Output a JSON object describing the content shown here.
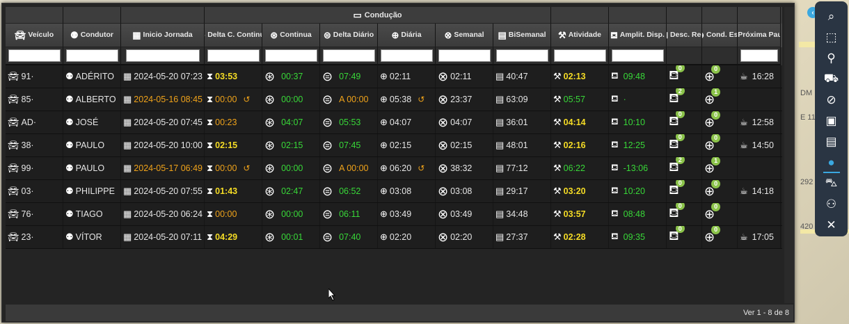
{
  "group_header": {
    "label": "Condução",
    "icon": "id-card-icon"
  },
  "columns": [
    {
      "key": "veiculo",
      "label": "Veículo",
      "icon": "car-icon",
      "width": 83,
      "filter": true
    },
    {
      "key": "condutor",
      "label": "Condutor",
      "icon": "user-gear-icon",
      "width": 83,
      "filter": true
    },
    {
      "key": "inicio",
      "label": "Inicio Jornada",
      "icon": "calendar-icon",
      "width": 120,
      "filter": true
    },
    {
      "key": "delta_c",
      "label": "Delta C. Continua",
      "icon": "steering-wheel-x-icon",
      "width": 83,
      "filter": true
    },
    {
      "key": "continua",
      "label": "Continua",
      "icon": "steering-wheel-x-icon",
      "width": 83,
      "filter": true
    },
    {
      "key": "delta_d",
      "label": "Delta Diário",
      "icon": "steering-hourglass-icon",
      "width": 83,
      "filter": true
    },
    {
      "key": "diaria",
      "label": "Diária",
      "icon": "steering-wheel-icon",
      "width": 83,
      "filter": true
    },
    {
      "key": "semanal",
      "label": "Semanal",
      "icon": "steering-calendar-icon",
      "width": 83,
      "filter": true
    },
    {
      "key": "bisemanal",
      "label": "BiSemanal",
      "icon": "calendar-id-icon",
      "width": 83,
      "filter": true
    },
    {
      "key": "atividade",
      "label": "Atividade",
      "icon": "tools-icon",
      "width": 83,
      "filter": true
    },
    {
      "key": "amplit",
      "label": "Amplit. Disp.",
      "icon": "bed-icon",
      "width": 83,
      "filter": true
    },
    {
      "key": "desc",
      "label": "Desc. Red.",
      "icon": "bed-icon",
      "width": 51,
      "filter": false
    },
    {
      "key": "cond",
      "label": "Cond. Est.",
      "icon": "steering-wheel-icon",
      "width": 51,
      "filter": false
    },
    {
      "key": "proxima",
      "label": "Próxima Pausa",
      "icon": "coffee-icon",
      "width": 62,
      "filter": true
    }
  ],
  "rows": [
    {
      "veiculo": "91·",
      "condutor": "ADÉRITO",
      "inicio": "2024-05-20 07:23",
      "inicio_color": "white",
      "delta_c": "03:53",
      "delta_c_color": "yellow",
      "delta_c_reset": false,
      "continua": "00:37",
      "delta_d": "07:49",
      "delta_d_prefix": "",
      "diaria": "02:11",
      "diaria_reset": false,
      "semanal": "02:11",
      "bisemanal": "40:47",
      "atividade": "02:13",
      "atividade_color": "yellow",
      "amplit": "09:48",
      "desc": "0",
      "cond": "0",
      "proxima": "16:28"
    },
    {
      "veiculo": "85·",
      "condutor": "ALBERTO",
      "inicio": "2024-05-16 08:45",
      "inicio_color": "orange",
      "delta_c": "00:00",
      "delta_c_color": "orange",
      "delta_c_reset": true,
      "continua": "00:00",
      "delta_d": "A 00:00",
      "delta_d_prefix": "orange",
      "diaria": "05:38",
      "diaria_reset": true,
      "semanal": "23:37",
      "bisemanal": "63:09",
      "atividade": "05:57",
      "atividade_color": "green",
      "amplit": "·",
      "desc": "2",
      "cond": "1",
      "proxima": ""
    },
    {
      "veiculo": "AD·",
      "condutor": "JOSÉ",
      "inicio": "2024-05-20 07:45",
      "inicio_color": "white",
      "delta_c": "00:23",
      "delta_c_color": "orange",
      "delta_c_reset": false,
      "continua": "04:07",
      "delta_d": "05:53",
      "delta_d_prefix": "",
      "diaria": "04:07",
      "diaria_reset": false,
      "semanal": "04:07",
      "bisemanal": "36:01",
      "atividade": "04:14",
      "atividade_color": "yellow",
      "amplit": "10:10",
      "desc": "0",
      "cond": "0",
      "proxima": "12:58"
    },
    {
      "veiculo": "38·",
      "condutor": "PAULO",
      "inicio": "2024-05-20 10:00",
      "inicio_color": "white",
      "delta_c": "02:15",
      "delta_c_color": "yellow",
      "delta_c_reset": false,
      "continua": "02:15",
      "delta_d": "07:45",
      "delta_d_prefix": "",
      "diaria": "02:15",
      "diaria_reset": false,
      "semanal": "02:15",
      "bisemanal": "48:01",
      "atividade": "02:16",
      "atividade_color": "yellow",
      "amplit": "12:25",
      "desc": "0",
      "cond": "0",
      "proxima": "14:50"
    },
    {
      "veiculo": "99·",
      "condutor": "PAULO",
      "inicio": "2024-05-17 06:49",
      "inicio_color": "orange",
      "delta_c": "00:00",
      "delta_c_color": "orange",
      "delta_c_reset": true,
      "continua": "00:00",
      "delta_d": "A 00:00",
      "delta_d_prefix": "orange",
      "diaria": "06:20",
      "diaria_reset": true,
      "semanal": "38:32",
      "bisemanal": "77:12",
      "atividade": "06:22",
      "atividade_color": "green",
      "amplit": "-13:06",
      "desc": "2",
      "cond": "1",
      "proxima": ""
    },
    {
      "veiculo": "03·",
      "condutor": "PHILIPPE",
      "inicio": "2024-05-20 07:55",
      "inicio_color": "white",
      "delta_c": "01:43",
      "delta_c_color": "yellow",
      "delta_c_reset": false,
      "continua": "02:47",
      "delta_d": "06:52",
      "delta_d_prefix": "",
      "diaria": "03:08",
      "diaria_reset": false,
      "semanal": "03:08",
      "bisemanal": "29:17",
      "atividade": "03:20",
      "atividade_color": "yellow",
      "amplit": "10:20",
      "desc": "0",
      "cond": "0",
      "proxima": "14:18"
    },
    {
      "veiculo": "76·",
      "condutor": "TIAGO",
      "inicio": "2024-05-20 06:24",
      "inicio_color": "white",
      "delta_c": "00:00",
      "delta_c_color": "orange",
      "delta_c_reset": false,
      "continua": "00:00",
      "delta_d": "06:11",
      "delta_d_prefix": "",
      "diaria": "03:49",
      "diaria_reset": false,
      "semanal": "03:49",
      "bisemanal": "34:48",
      "atividade": "03:57",
      "atividade_color": "yellow",
      "amplit": "08:48",
      "desc": "0",
      "cond": "0",
      "proxima": ""
    },
    {
      "veiculo": "23·",
      "condutor": "VÍTOR",
      "inicio": "2024-05-20 07:11",
      "inicio_color": "white",
      "delta_c": "04:29",
      "delta_c_color": "yellow",
      "delta_c_reset": false,
      "continua": "00:01",
      "delta_d": "07:40",
      "delta_d_prefix": "",
      "diaria": "02:20",
      "diaria_reset": false,
      "semanal": "02:20",
      "bisemanal": "27:37",
      "atividade": "02:28",
      "atividade_color": "yellow",
      "amplit": "09:35",
      "desc": "0",
      "cond": "0",
      "proxima": "17:05"
    }
  ],
  "footer": {
    "text": "Ver 1 - 8 de 8"
  },
  "sidebar": [
    {
      "icon": "search-icon",
      "glyph": "⌕",
      "active": false
    },
    {
      "icon": "select-area-icon",
      "glyph": "⬚",
      "active": false
    },
    {
      "icon": "map-marker-icon",
      "glyph": "⚲",
      "active": false
    },
    {
      "icon": "truck-icon",
      "glyph": "⛟",
      "active": false
    },
    {
      "icon": "eye-slash-icon",
      "glyph": "⊘",
      "active": false
    },
    {
      "icon": "images-icon",
      "glyph": "▣",
      "active": false
    },
    {
      "icon": "map-icon",
      "glyph": "▤",
      "active": false
    },
    {
      "icon": "user-icon",
      "glyph": "●",
      "active": true
    },
    {
      "icon": "cars-icon",
      "glyph": "⛍",
      "active": false
    },
    {
      "icon": "users-icon",
      "glyph": "⚇",
      "active": false
    },
    {
      "icon": "tools-icon",
      "glyph": "✕",
      "active": false
    }
  ],
  "map_labels": [
    "DM",
    "E 11",
    "292",
    "420"
  ],
  "colors": {
    "yellow": "#f5dc25",
    "orange": "#f0a31a",
    "green": "#38d838",
    "accent": "#3aa8e0"
  }
}
